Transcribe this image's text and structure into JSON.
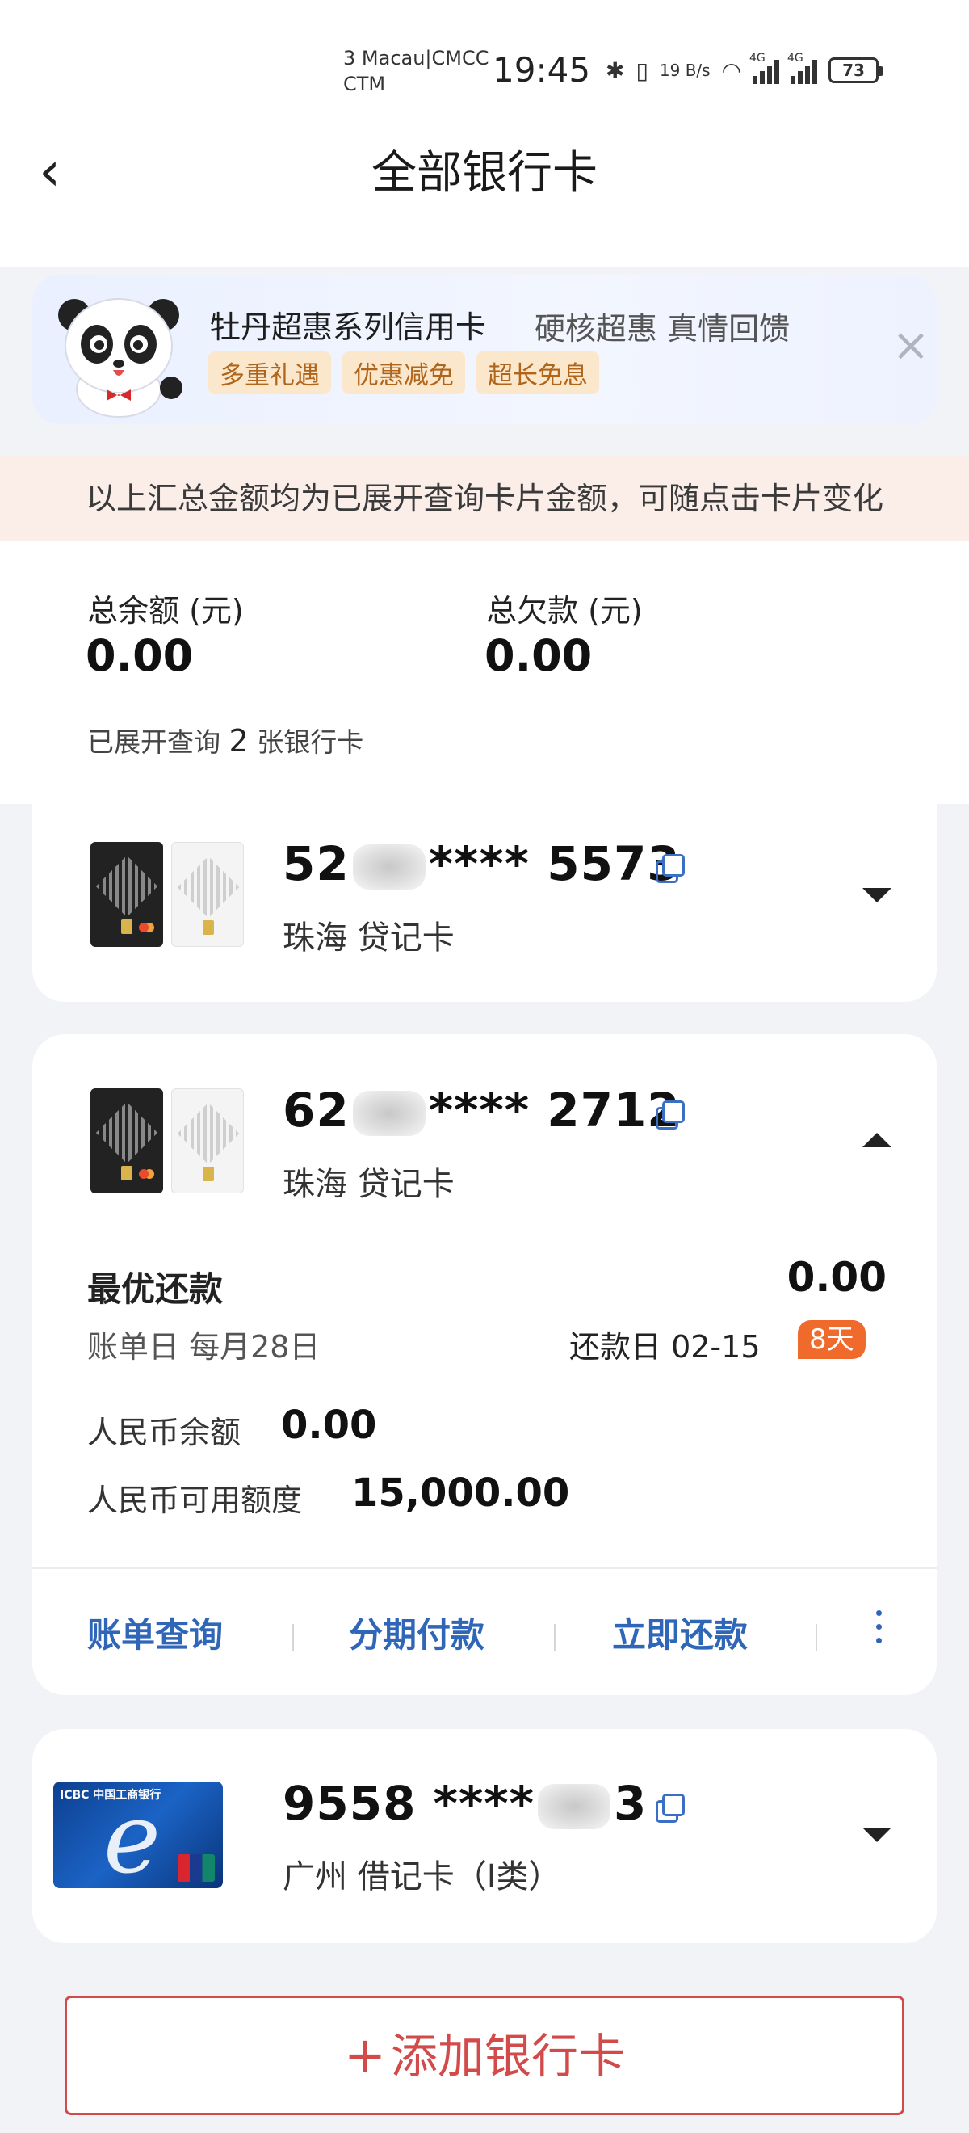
{
  "status_bar": {
    "carrier": "3 Macau|CMCC CTM",
    "time": "19:45",
    "net_speed": "19 B/s",
    "signal_tag_1": "4G",
    "signal_tag_2": "4G",
    "battery": "73",
    "icons": [
      "bluetooth-icon",
      "vibrate-icon",
      "wifi-icon",
      "signal-icon",
      "battery-icon"
    ]
  },
  "header": {
    "title": "全部银行卡"
  },
  "promo": {
    "title": "牡丹超惠系列信用卡",
    "subtitle": "硬核超惠 真情回馈",
    "tags": [
      "多重礼遇",
      "优惠减免",
      "超长免息"
    ]
  },
  "notice": "以上汇总金额均为已展开查询卡片金额，可随点击卡片变化",
  "summary": {
    "balance_label": "总余额 (元)",
    "balance_value": "0.00",
    "debt_label": "总欠款 (元)",
    "debt_value": "0.00",
    "count_prefix": "已展开查询",
    "count": "2",
    "count_suffix": "张银行卡"
  },
  "cards": [
    {
      "number_prefix": "52",
      "number_suffix": "**** 5573",
      "region": "珠海 贷记卡",
      "expanded": false
    },
    {
      "number_prefix": "62",
      "number_suffix": "**** 2712",
      "region": "珠海 贷记卡",
      "expanded": true,
      "best_repay_label": "最优还款",
      "best_repay_value": "0.00",
      "bill_day": "账单日 每月28日",
      "repay_day": "还款日 02-15",
      "days_left": "8天",
      "rmb_balance_label": "人民币余额",
      "rmb_balance_value": "0.00",
      "rmb_credit_label": "人民币可用额度",
      "rmb_credit_value": "15,000.00",
      "actions": [
        "账单查询",
        "分期付款",
        "立即还款"
      ]
    },
    {
      "number_prefix": "9558 ****",
      "number_suffix": "3",
      "region": "广州 借记卡（I类）",
      "expanded": false,
      "card_brand": "ICBC 中国工商银行"
    }
  ],
  "add_card_label": "添加银行卡",
  "colors": {
    "accent_blue": "#3066b8",
    "accent_red": "#d24a4a",
    "badge_orange": "#f06a2b"
  }
}
